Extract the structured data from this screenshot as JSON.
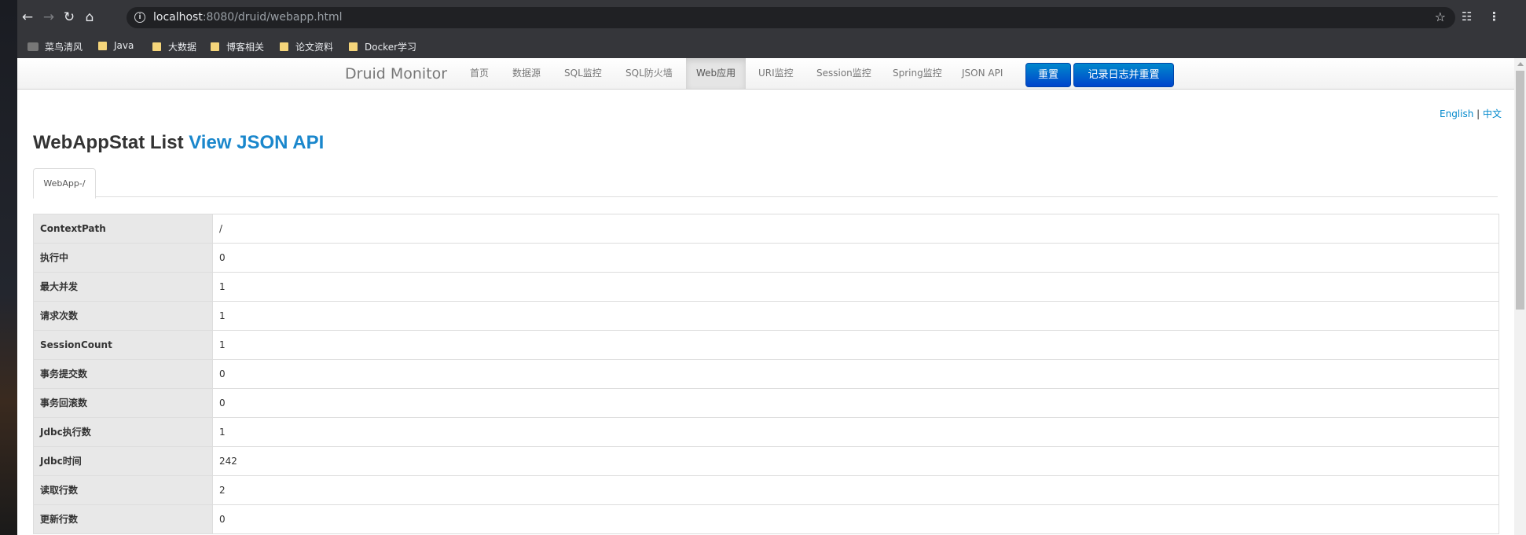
{
  "browser": {
    "url_host": "localhost",
    "url_rest": ":8080/druid/webapp.html",
    "bookmarks": [
      "菜鸟清风",
      "Java",
      "大数据",
      "博客相关",
      "论文资料",
      "Docker学习"
    ]
  },
  "navbar": {
    "brand": "Druid Monitor",
    "items": [
      "首页",
      "数据源",
      "SQL监控",
      "SQL防火墙",
      "Web应用",
      "URI监控",
      "Session监控",
      "Spring监控",
      "JSON API"
    ],
    "active": "Web应用",
    "reset_label": "重置",
    "log_reset_label": "记录日志并重置"
  },
  "lang": {
    "english": "English",
    "sep": "|",
    "chinese": "中文"
  },
  "header": {
    "title": "WebAppStat List",
    "json_link": "View JSON API"
  },
  "tab": {
    "label": "WebApp-/"
  },
  "stats": [
    {
      "key": "ContextPath",
      "value": "/"
    },
    {
      "key": "执行中",
      "value": "0"
    },
    {
      "key": "最大并发",
      "value": "1"
    },
    {
      "key": "请求次数",
      "value": "1"
    },
    {
      "key": "SessionCount",
      "value": "1"
    },
    {
      "key": "事务提交数",
      "value": "0"
    },
    {
      "key": "事务回滚数",
      "value": "0"
    },
    {
      "key": "Jdbc执行数",
      "value": "1"
    },
    {
      "key": "Jdbc时间",
      "value": "242"
    },
    {
      "key": "读取行数",
      "value": "2"
    },
    {
      "key": "更新行数",
      "value": "0"
    }
  ],
  "colors": {
    "primary": "#0071cc",
    "link": "#1a87cc",
    "chrome": "#35363a"
  }
}
